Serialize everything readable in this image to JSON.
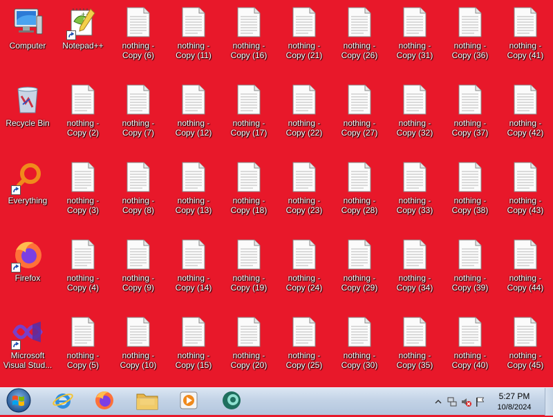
{
  "desktop": {
    "system_icons": [
      {
        "label": "Computer",
        "icon": "computer-icon",
        "name": "desktop-icon-computer"
      },
      {
        "label": "Recycle Bin",
        "icon": "recycle-bin-icon",
        "name": "desktop-icon-recycle-bin"
      },
      {
        "label": "Everything",
        "icon": "everything-icon",
        "name": "desktop-icon-everything"
      },
      {
        "label": "Firefox",
        "icon": "firefox-icon",
        "name": "desktop-icon-firefox"
      },
      {
        "label": "Microsoft\nVisual Stud...",
        "icon": "visual-studio-icon",
        "name": "desktop-icon-visual-studio"
      }
    ],
    "notepadpp": {
      "label": "Notepad++",
      "icon": "notepadpp-icon"
    },
    "files": [
      "nothing -\nCopy (2)",
      "nothing -\nCopy (3)",
      "nothing -\nCopy (4)",
      "nothing -\nCopy (5)",
      "nothing -\nCopy (6)",
      "nothing -\nCopy (7)",
      "nothing -\nCopy (8)",
      "nothing -\nCopy (9)",
      "nothing -\nCopy (10)",
      "nothing -\nCopy (11)",
      "nothing -\nCopy (12)",
      "nothing -\nCopy (13)",
      "nothing -\nCopy (14)",
      "nothing -\nCopy (15)",
      "nothing -\nCopy (16)",
      "nothing -\nCopy (17)",
      "nothing -\nCopy (18)",
      "nothing -\nCopy (19)",
      "nothing -\nCopy (20)",
      "nothing -\nCopy (21)",
      "nothing -\nCopy (22)",
      "nothing -\nCopy (23)",
      "nothing -\nCopy (24)",
      "nothing -\nCopy (25)",
      "nothing -\nCopy (26)",
      "nothing -\nCopy (27)",
      "nothing -\nCopy (28)",
      "nothing -\nCopy (29)",
      "nothing -\nCopy (30)",
      "nothing -\nCopy (31)",
      "nothing -\nCopy (32)",
      "nothing -\nCopy (33)",
      "nothing -\nCopy (34)",
      "nothing -\nCopy (35)",
      "nothing -\nCopy (36)",
      "nothing -\nCopy (37)",
      "nothing -\nCopy (38)",
      "nothing -\nCopy (39)",
      "nothing -\nCopy (40)",
      "nothing -\nCopy (41)",
      "nothing -\nCopy (42)",
      "nothing -\nCopy (43)",
      "nothing -\nCopy (44)",
      "nothing -\nCopy (45)"
    ],
    "file_icon": "text-document-icon",
    "background_color": "#e8182a"
  },
  "taskbar": {
    "start": {
      "icon": "windows-start-orb-icon"
    },
    "pinned": [
      {
        "name": "taskbar-internet-explorer",
        "icon": "internet-explorer-icon"
      },
      {
        "name": "taskbar-firefox",
        "icon": "firefox-icon"
      },
      {
        "name": "taskbar-file-explorer",
        "icon": "folder-icon"
      },
      {
        "name": "taskbar-media-player",
        "icon": "media-player-icon"
      },
      {
        "name": "taskbar-app",
        "icon": "app-icon"
      }
    ],
    "tray": {
      "icons": [
        "show-hidden-icons-chevron-icon",
        "network-icon",
        "volume-muted-icon",
        "action-center-flag-icon"
      ],
      "time": "5:27 PM",
      "date": "10/8/2024"
    }
  }
}
